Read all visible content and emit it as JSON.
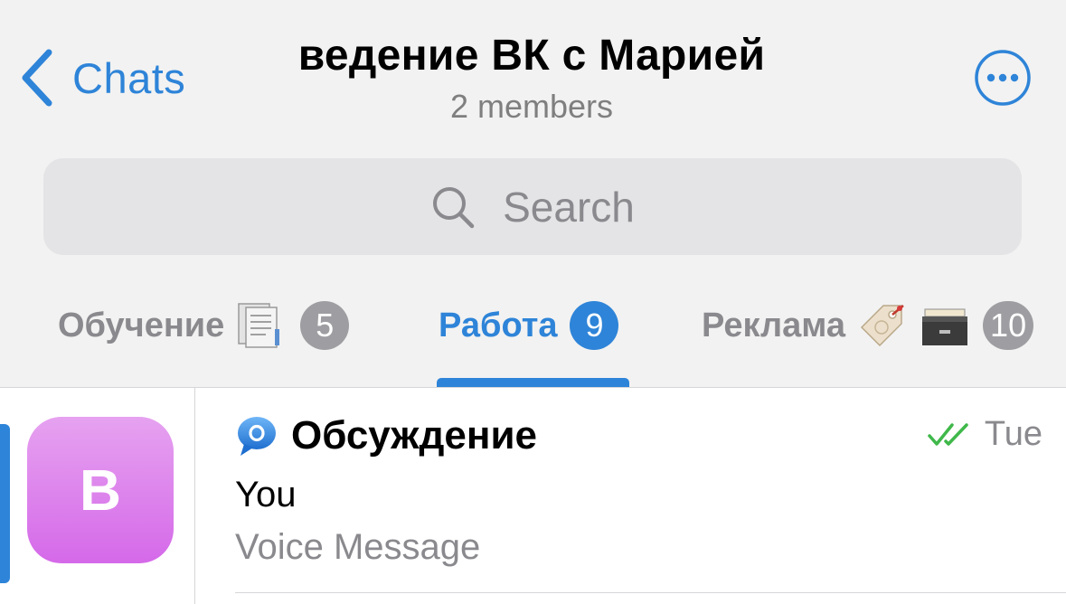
{
  "header": {
    "back_label": "Chats",
    "title": "ведение ВК с Марией",
    "subtitle": "2 members"
  },
  "search": {
    "placeholder": "Search"
  },
  "tabs": [
    {
      "label": "Обучение",
      "badge": "5",
      "active": false
    },
    {
      "label": "Работа",
      "badge": "9",
      "active": true
    },
    {
      "label": "Реклама",
      "badge": "10",
      "active": false
    }
  ],
  "chats": [
    {
      "avatar_letter": "B",
      "name": "Обсуждение",
      "sender": "You",
      "preview": "Voice Message",
      "time": "Tue",
      "read_status": "double-check"
    }
  ],
  "colors": {
    "accent": "#2e84d8",
    "badge_inactive": "#9e9ea2",
    "read_check": "#3fb84a",
    "avatar_gradient_top": "#e6a2f0",
    "avatar_gradient_bottom": "#d569e9"
  }
}
